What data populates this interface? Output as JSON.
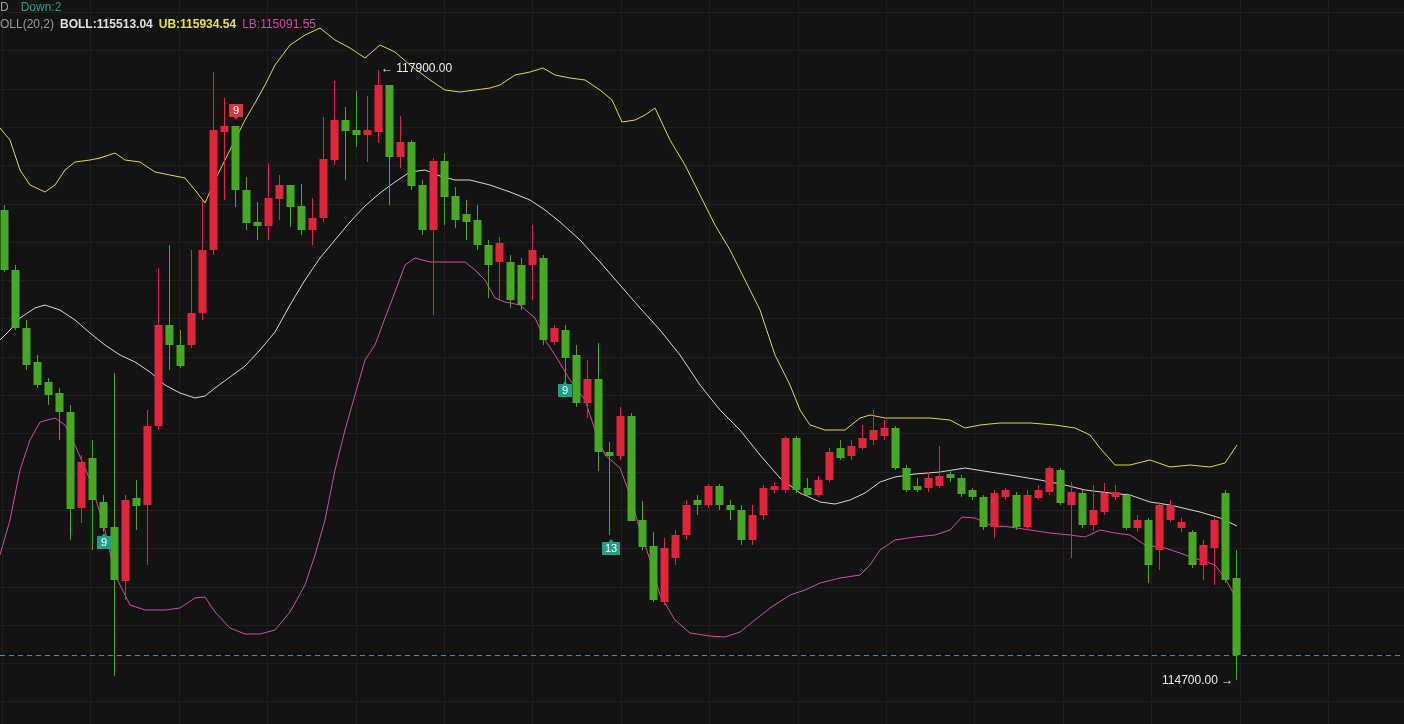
{
  "indicator_legend": [
    {
      "kind": "title",
      "text": "D"
    },
    {
      "kind": "down",
      "text": "Down:2"
    }
  ],
  "bollinger_legend": [
    {
      "kind": "title",
      "text": "OLL(20,2)"
    },
    {
      "kind": "mid",
      "text": "BOLL:115513.04"
    },
    {
      "kind": "upper",
      "text": "UB:115934.54"
    },
    {
      "kind": "lower",
      "text": "LB:115091.55"
    }
  ],
  "markers": [
    {
      "label": "9",
      "kind": "below"
    },
    {
      "label": "9",
      "kind": "above"
    },
    {
      "label": "9",
      "kind": "below"
    },
    {
      "label": "13",
      "kind": "below"
    }
  ],
  "high_price_label": "← 117900.00",
  "low_price_label": "114700.00 →"
}
